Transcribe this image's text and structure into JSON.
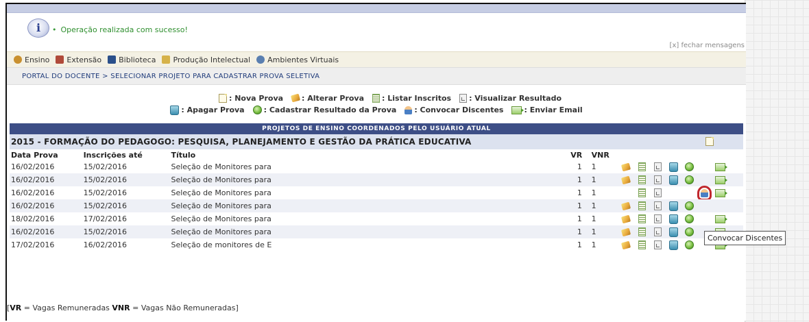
{
  "message": {
    "text": "Operação realizada com sucesso!",
    "close": "[x] fechar mensagens"
  },
  "menu": [
    {
      "label": "Ensino",
      "icon": "ensino-icon",
      "color": "#c9902f"
    },
    {
      "label": "Extensão",
      "icon": "extensao-icon",
      "color": "#b04a3a"
    },
    {
      "label": "Biblioteca",
      "icon": "biblioteca-icon",
      "color": "#2a4f8a"
    },
    {
      "label": "Produção Intelectual",
      "icon": "producao-intelectual-icon",
      "color": "#d6b24a"
    },
    {
      "label": "Ambientes Virtuais",
      "icon": "ambientes-virtuais-icon",
      "color": "#5a7fb0"
    }
  ],
  "breadcrumb": "PORTAL DO DOCENTE > SELECIONAR PROJETO PARA CADASTRAR PROVA SELETIVA",
  "legend": {
    "row1": [
      {
        "icon": "new",
        "label": ": Nova Prova"
      },
      {
        "icon": "edit",
        "label": ": Alterar Prova"
      },
      {
        "icon": "list",
        "label": ": Listar Inscritos"
      },
      {
        "icon": "view",
        "label": ": Visualizar Resultado"
      }
    ],
    "row2": [
      {
        "icon": "trash",
        "label": ": Apagar Prova"
      },
      {
        "icon": "ok",
        "label": ": Cadastrar Resultado da Prova"
      },
      {
        "icon": "users",
        "label": ": Convocar Discentes"
      },
      {
        "icon": "mail",
        "label": ": Enviar Email"
      }
    ]
  },
  "section_header": "PROJETOS DE ENSINO COORDENADOS PELO USUÁRIO ATUAL",
  "project_title": "2015 - FORMAÇÃO DO PEDAGOGO: PESQUISA, PLANEJAMENTO E GESTÃO DA PRÁTICA EDUCATIVA",
  "table": {
    "headers": {
      "date": "Data Prova",
      "insc": "Inscrições até",
      "title": "Título",
      "vr": "VR",
      "vnr": "VNR"
    },
    "rows": [
      {
        "date": "16/02/2016",
        "insc": "15/02/2016",
        "title": "Seleção de Monitores para",
        "vr": "1",
        "vnr": "1"
      },
      {
        "date": "16/02/2016",
        "insc": "15/02/2016",
        "title": "Seleção de Monitores para",
        "vr": "1",
        "vnr": "1"
      },
      {
        "date": "16/02/2016",
        "insc": "15/02/2016",
        "title": "Seleção de Monitores para",
        "vr": "1",
        "vnr": "1"
      },
      {
        "date": "16/02/2016",
        "insc": "15/02/2016",
        "title": "Seleção de Monitores para",
        "vr": "1",
        "vnr": "1"
      },
      {
        "date": "18/02/2016",
        "insc": "17/02/2016",
        "title": "Seleção de Monitores para",
        "vr": "1",
        "vnr": "1"
      },
      {
        "date": "16/02/2016",
        "insc": "15/02/2016",
        "title": "Seleção de Monitores para",
        "vr": "1",
        "vnr": "1"
      },
      {
        "date": "17/02/2016",
        "insc": "16/02/2016",
        "title": "Seleção de monitores de E",
        "vr": "1",
        "vnr": "1"
      }
    ]
  },
  "tooltip": "Convocar Discentes",
  "footer": {
    "vr": "VR",
    "vr_text": " = Vagas Remuneradas ",
    "vnr": "VNR",
    "vnr_text": " = Vagas Não Remuneradas]",
    "open": "["
  }
}
